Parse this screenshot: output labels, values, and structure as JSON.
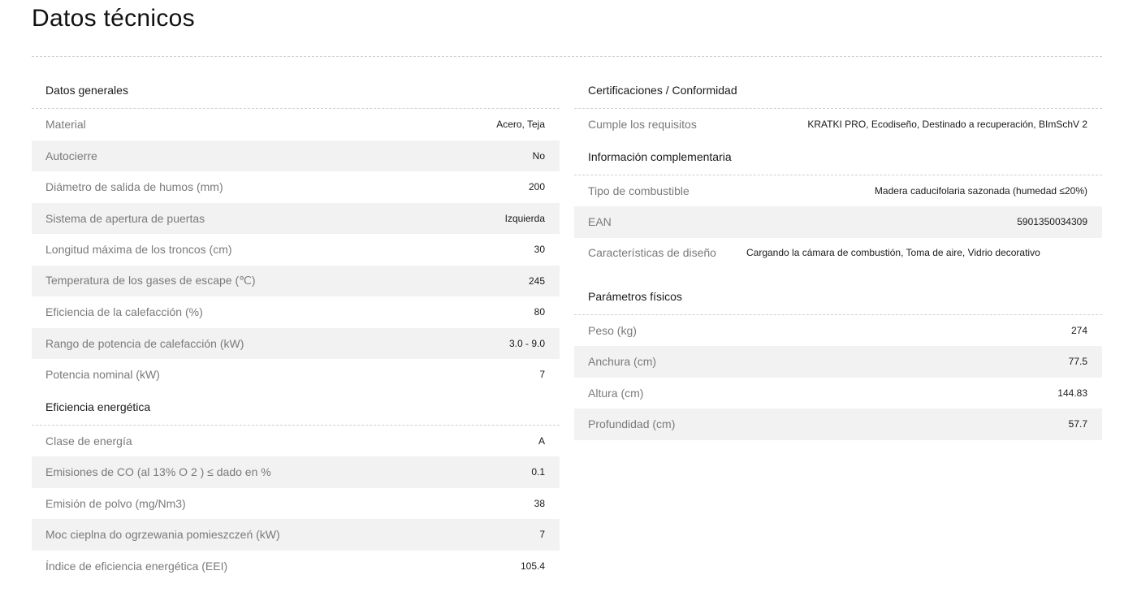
{
  "page_title": "Datos técnicos",
  "left": {
    "sections": [
      {
        "title": "Datos generales",
        "rows": [
          {
            "label": "Material",
            "value": "Acero, Teja"
          },
          {
            "label": "Autocierre",
            "value": "No"
          },
          {
            "label": "Diámetro de salida de humos (mm)",
            "value": "200"
          },
          {
            "label": "Sistema de apertura de puertas",
            "value": "Izquierda"
          },
          {
            "label": "Longitud máxima de los troncos (cm)",
            "value": "30"
          },
          {
            "label": "Temperatura de los gases de escape (℃)",
            "value": "245"
          },
          {
            "label": "Eficiencia de la calefacción (%)",
            "value": "80"
          },
          {
            "label": "Rango de potencia de calefacción (kW)",
            "value": "3.0 - 9.0"
          },
          {
            "label": "Potencia nominal (kW)",
            "value": "7"
          }
        ]
      },
      {
        "title": "Eficiencia energética",
        "rows": [
          {
            "label": "Clase de energía",
            "value": "A"
          },
          {
            "label": "Emisiones de CO (al 13% O 2 ) ≤ dado en %",
            "value": "0.1"
          },
          {
            "label": "Emisión de polvo (mg/Nm3)",
            "value": "38"
          },
          {
            "label": "Moc cieplna do ogrzewania pomieszczeń (kW)",
            "value": "7"
          },
          {
            "label": "Índice de eficiencia energética (EEI)",
            "value": "105.4"
          }
        ]
      }
    ]
  },
  "right": {
    "sections": [
      {
        "title": "Certificaciones / Conformidad",
        "rows": [
          {
            "label": "Cumple los requisitos",
            "value": "KRATKI PRO, Ecodiseño, Destinado a recuperación, BImSchV 2"
          }
        ]
      },
      {
        "title": "Información complementaria",
        "rows": [
          {
            "label": "Tipo de combustible",
            "value": "Madera caducifolaria sazonada (humedad ≤20%)"
          },
          {
            "label": "EAN",
            "value": "5901350034309"
          },
          {
            "label": "Características de diseño",
            "value": "Cargando la cámara de combustión, Toma de aire, Vidrio decorativo"
          }
        ]
      },
      {
        "title": "Parámetros físicos",
        "rows": [
          {
            "label": "Peso (kg)",
            "value": "274"
          },
          {
            "label": "Anchura (cm)",
            "value": "77.5"
          },
          {
            "label": "Altura (cm)",
            "value": "144.83"
          },
          {
            "label": "Profundidad (cm)",
            "value": "57.7"
          }
        ]
      }
    ]
  }
}
